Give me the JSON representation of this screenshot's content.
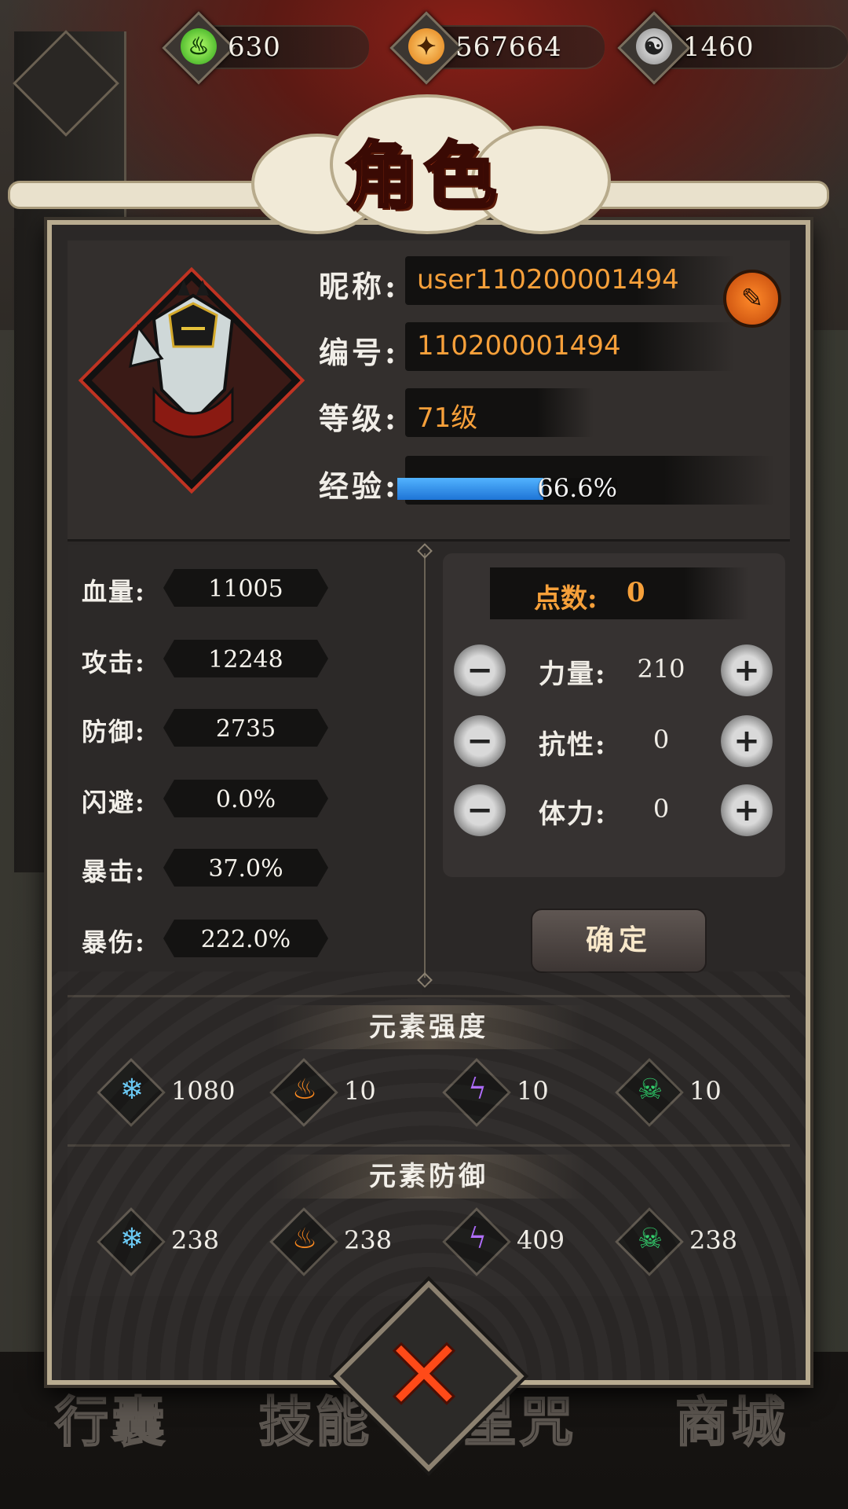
{
  "resources": [
    {
      "icon": "green-flame-icon",
      "value": "630",
      "color": "#3ecb2a"
    },
    {
      "icon": "gold-coin-icon",
      "value": "567664",
      "color": "#f4a52a"
    },
    {
      "icon": "silver-swirl-icon",
      "value": "1460",
      "color": "#bfbfbf"
    }
  ],
  "title": "角色",
  "profile": {
    "nickname_label": "昵称:",
    "nickname": "user110200001494",
    "id_label": "编号:",
    "id": "110200001494",
    "level_label": "等级:",
    "level": "71级",
    "exp_label": "经验:",
    "exp_text": "66.6%",
    "exp_progress": 0.666
  },
  "stats": [
    {
      "label": "血量:",
      "value": "11005"
    },
    {
      "label": "攻击:",
      "value": "12248"
    },
    {
      "label": "防御:",
      "value": "2735"
    },
    {
      "label": "闪避:",
      "value": "0.0%"
    },
    {
      "label": "暴击:",
      "value": "37.0%"
    },
    {
      "label": "暴伤:",
      "value": "222.0%"
    }
  ],
  "points": {
    "label": "点数:",
    "value": "0",
    "attributes": [
      {
        "label": "力量:",
        "value": "210"
      },
      {
        "label": "抗性:",
        "value": "0"
      },
      {
        "label": "体力:",
        "value": "0"
      }
    ],
    "minus": "−",
    "plus": "+"
  },
  "confirm_label": "确定",
  "element_strength": {
    "title": "元素强度",
    "items": [
      {
        "icon": "ice-snowflake-icon",
        "value": "1080",
        "color": "#6fd2ff"
      },
      {
        "icon": "fire-flame-icon",
        "value": "10",
        "color": "#ff8a1e"
      },
      {
        "icon": "lightning-icon",
        "value": "10",
        "color": "#b06cff"
      },
      {
        "icon": "poison-skull-icon",
        "value": "10",
        "color": "#2fcf6a"
      }
    ]
  },
  "element_defense": {
    "title": "元素防御",
    "items": [
      {
        "icon": "ice-snowflake-icon",
        "value": "238",
        "color": "#6fd2ff"
      },
      {
        "icon": "fire-flame-icon",
        "value": "238",
        "color": "#ff8a1e"
      },
      {
        "icon": "lightning-icon",
        "value": "409",
        "color": "#b06cff"
      },
      {
        "icon": "poison-skull-icon",
        "value": "238",
        "color": "#2fcf6a"
      }
    ]
  },
  "bottom_nav": [
    "行囊",
    "技能",
    "星咒",
    "商城"
  ]
}
